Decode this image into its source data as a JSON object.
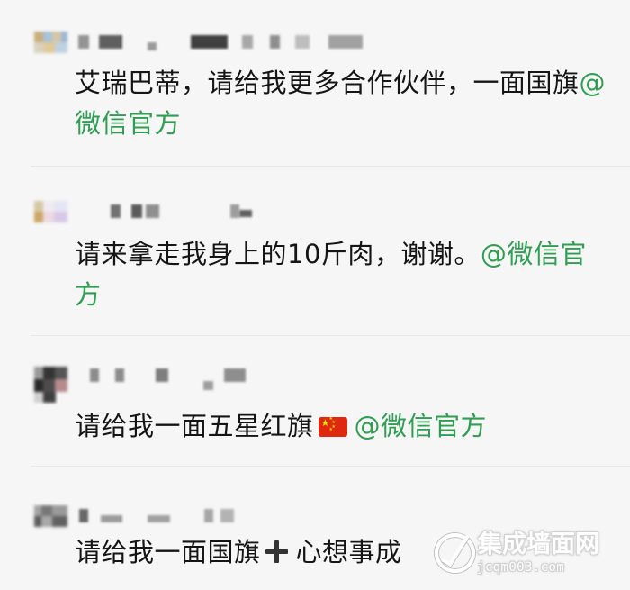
{
  "comments": [
    {
      "text": "艾瑞巴蒂，请给我更多合作伙伴，一面国旗",
      "mention": "@微信官方"
    },
    {
      "text": "请来拿走我身上的10斤肉，谢谢。",
      "mention": "@微信官方"
    },
    {
      "text_before": "请给我一面五星红旗",
      "icon": "china-flag-icon",
      "mention": "@微信官方"
    },
    {
      "text_before": "请给我一面国旗",
      "icon": "plus-icon",
      "text_after": "心想事成"
    }
  ],
  "watermark": {
    "brand": "集成墙面网",
    "url": "jcqm003.com"
  },
  "colors": {
    "mention": "#2f9e52",
    "background": "#f6f6f6",
    "divider": "#e7e7e7",
    "flag_red": "#de2910",
    "flag_star": "#ffde00"
  }
}
